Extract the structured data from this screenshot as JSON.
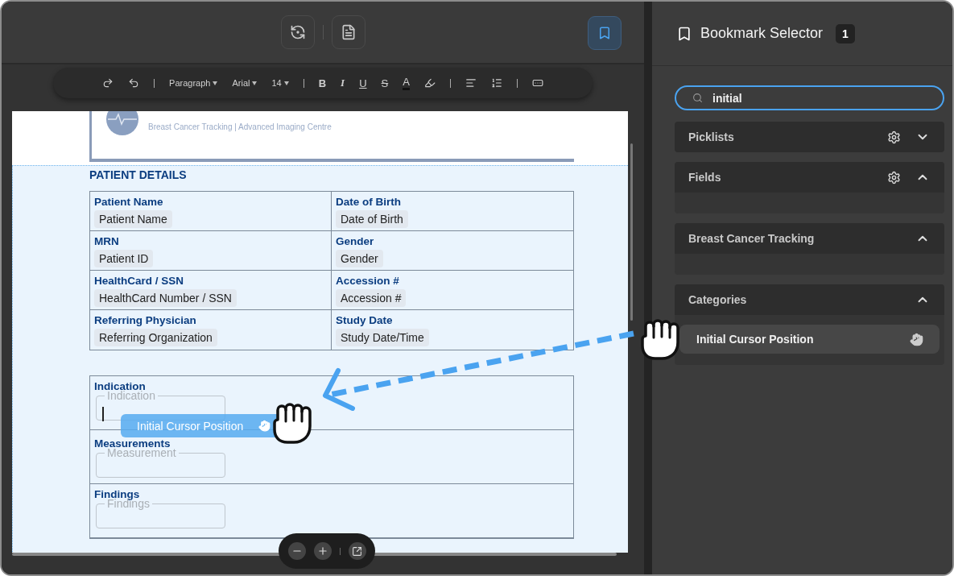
{
  "top_bar": {
    "buttons": [
      {
        "kind": "sync"
      },
      {
        "kind": "doc-info"
      }
    ],
    "bookmark_toggle": {
      "selected": true
    }
  },
  "format_toolbar": [
    {
      "kind": "redo"
    },
    {
      "kind": "undo"
    },
    {
      "kind": "sep"
    },
    {
      "kind": "dropdown",
      "label": "Paragraph"
    },
    {
      "kind": "dropdown",
      "label": "Arial"
    },
    {
      "kind": "dropdown",
      "label": "14"
    },
    {
      "kind": "sep"
    },
    {
      "kind": "bold",
      "label": "B"
    },
    {
      "kind": "italic",
      "label": "I"
    },
    {
      "kind": "underline",
      "label": "U"
    },
    {
      "kind": "strike",
      "label": "S"
    },
    {
      "kind": "color",
      "label": "A"
    },
    {
      "kind": "highlight"
    },
    {
      "kind": "sep"
    },
    {
      "kind": "align"
    },
    {
      "kind": "spacing"
    },
    {
      "kind": "sep"
    },
    {
      "kind": "insert"
    }
  ],
  "document": {
    "header_subtitle": "Breast Cancer Tracking | Advanced Imaging Centre",
    "section_title": "PATIENT DETAILS",
    "details": [
      {
        "label": "Patient Name",
        "value": "Patient Name"
      },
      {
        "label": "Date of Birth",
        "value": "Date of Birth"
      },
      {
        "label": "MRN",
        "value": "Patient ID"
      },
      {
        "label": "Gender",
        "value": "Gender"
      },
      {
        "label": "HealthCard / SSN",
        "value": "HealthCard Number / SSN"
      },
      {
        "label": "Accession #",
        "value": "Accession #"
      },
      {
        "label": "Referring Physician",
        "value": "Referring Organization"
      },
      {
        "label": "Study Date",
        "value": "Study Date/Time"
      }
    ],
    "sections": [
      {
        "label": "Indication",
        "placeholder": "Indication",
        "focused": true
      },
      {
        "label": "Measurements",
        "placeholder": "Measurement",
        "focused": false
      },
      {
        "label": "Findings",
        "placeholder": "Findings",
        "focused": false
      }
    ]
  },
  "zoom_controls": [
    {
      "kind": "zoom-out"
    },
    {
      "kind": "zoom-in"
    },
    {
      "kind": "sep"
    },
    {
      "kind": "open-external"
    }
  ],
  "drag_ghost": {
    "label": "Initial Cursor Position"
  },
  "sidebar": {
    "title": "Bookmark Selector",
    "count": "1",
    "search": {
      "value": "initial"
    },
    "groups": [
      {
        "title": "Picklists",
        "settings": true,
        "expanded": false
      },
      {
        "title": "Fields",
        "settings": true,
        "expanded": true
      },
      {
        "title": "Breast Cancer Tracking",
        "settings": false,
        "expanded": true
      },
      {
        "title": "Categories",
        "settings": false,
        "expanded": true,
        "items": [
          {
            "label": "Initial Cursor Position"
          }
        ]
      }
    ]
  }
}
